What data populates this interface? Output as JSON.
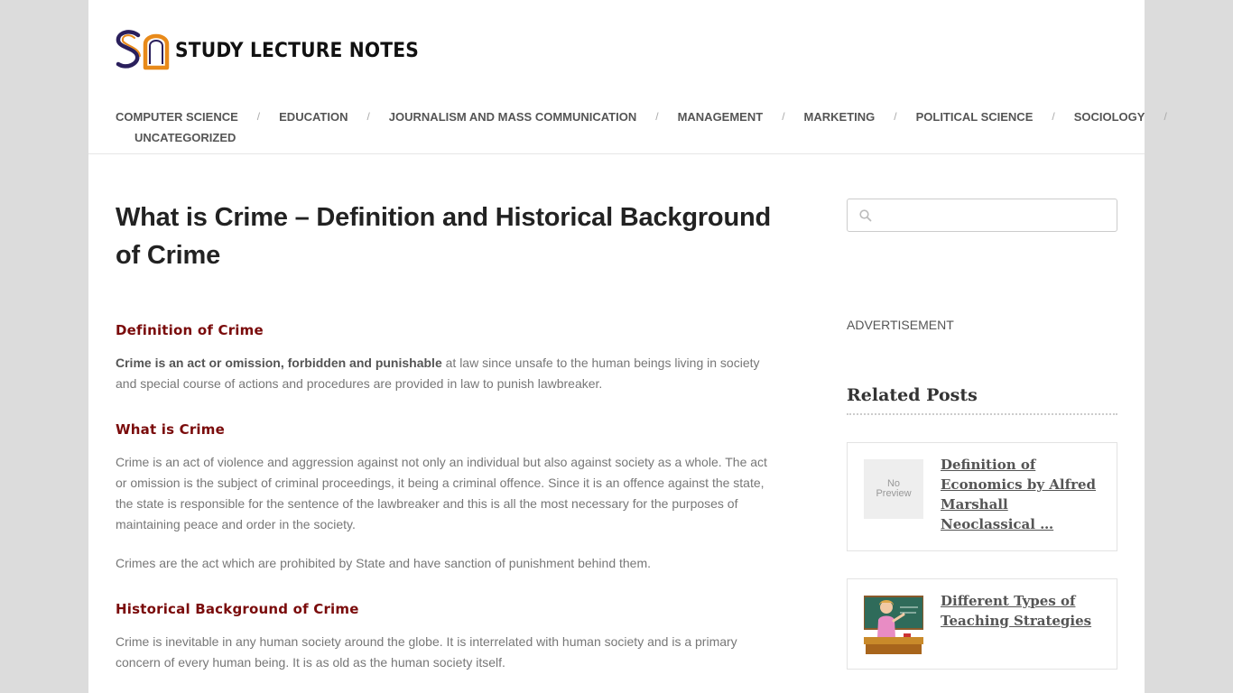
{
  "site": {
    "logo_text": "STUDY LECTURE NOTES"
  },
  "nav": {
    "items": [
      {
        "label": "COMPUTER SCIENCE"
      },
      {
        "label": "EDUCATION"
      },
      {
        "label": "JOURNALISM AND MASS COMMUNICATION"
      },
      {
        "label": "MANAGEMENT"
      },
      {
        "label": "MARKETING"
      },
      {
        "label": "POLITICAL SCIENCE"
      },
      {
        "label": "SOCIOLOGY"
      },
      {
        "label": "UNCATEGORIZED"
      }
    ],
    "separator": "/"
  },
  "article": {
    "title": "What is Crime – Definition and Historical Background of Crime",
    "sections": [
      {
        "heading": "Definition of Crime",
        "paragraphs": [
          {
            "bold": "Crime is an act or omission, forbidden and punishable",
            "text": " at law since unsafe to the human beings living in society and special course of actions and procedures are provided in law to punish lawbreaker."
          }
        ]
      },
      {
        "heading": "What is Crime",
        "paragraphs": [
          {
            "text": "Crime is an act of violence and aggression against not only an individual but also against society as a whole. The act or omission is the subject of criminal proceedings, it being a criminal offence. Since it is an offence against the state, the state is responsible for the sentence of the lawbreaker and this is all the most necessary for the purposes of maintaining peace and order in the society."
          },
          {
            "text": "Crimes are the act which are prohibited by State and have sanction of punishment behind them."
          }
        ]
      },
      {
        "heading": "Historical Background of Crime",
        "paragraphs": [
          {
            "text": "Crime is inevitable in any human society around the globe. It is interrelated with human society and is a primary concern of every human being. It is as old as the human society itself."
          }
        ]
      }
    ]
  },
  "sidebar": {
    "search": {
      "placeholder": "",
      "value": ""
    },
    "advertisement_label": "ADVERTISEMENT",
    "related_title": "Related Posts",
    "related": [
      {
        "title": "Definition of Economics by Alfred Marshall Neoclassical …",
        "thumb_text": "No Preview",
        "thumb": "no-preview"
      },
      {
        "title": "Different Types of Teaching Strategies",
        "thumb": "teacher-illustration"
      }
    ]
  },
  "colors": {
    "heading_accent": "#7a0b0b",
    "logo_orange": "#e88a1a",
    "logo_navy": "#2a1f5c"
  }
}
